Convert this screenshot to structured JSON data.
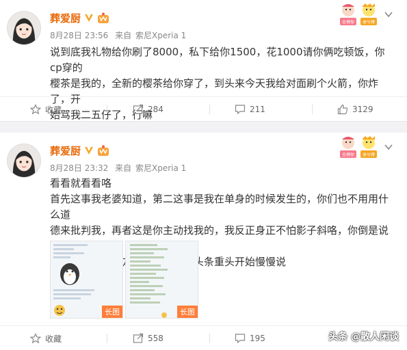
{
  "posts": [
    {
      "author": "葬爱厨",
      "time": "8月28日 23:56",
      "source_prefix": "来自",
      "source": "索尼Xperia 1",
      "lines": [
        "说到底我礼物给你刷了8000，私下给你1500，花1000请你俩吃顿饭，你cp穿的",
        "樱茶是我的，全新的樱茶给你穿了，到头来今天我给对面刷个火箭，你炸了，开",
        "始骂我二五仔了，行嘛"
      ],
      "actions": {
        "favorite": "收藏",
        "repost": "284",
        "comment": "211",
        "like": "3129"
      }
    },
    {
      "author": "葬爱厨",
      "time": "8月28日 23:32",
      "source_prefix": "来自",
      "source": "索尼Xperia 1",
      "lines": [
        "看看就看看咯",
        "首先这事我老婆知道，第二这事是我在单身的时候发生的，你们也不用用什么道",
        "德来批判我，再者这是你主动找我的，我反正身正不怕影子斜咯，你倒是说说我",
        "有什么做错的地方嘛？晚点写个头条重头开始慢慢说"
      ],
      "images": [
        {
          "tag": "长图"
        },
        {
          "tag": "长图"
        }
      ],
      "actions": {
        "favorite": "收藏",
        "repost": "558",
        "comment": "195"
      }
    }
  ],
  "stickers": [
    "合得你",
    "米兮得"
  ],
  "watermark": "头条 @散人闲谈",
  "colors": {
    "author": "#e86b0c",
    "badge": "#f5a623",
    "tag": "#ff7e3a"
  }
}
